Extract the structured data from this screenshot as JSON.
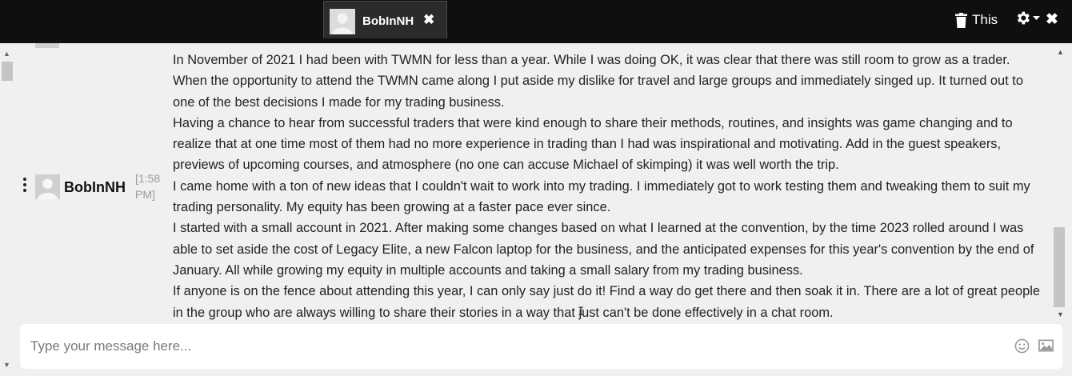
{
  "tab": {
    "name": "BobInNH",
    "close_glyph": "✖"
  },
  "top_actions": {
    "clear_label": "This",
    "trash_icon": "trash-icon",
    "settings_icon": "gear-icon",
    "close_glyph": "✖"
  },
  "message": {
    "author": "BobInNH",
    "time": "[1:58 PM]",
    "paragraphs": [
      "In November of 2021 I had been with TWMN for less than a year. While I was doing OK, it was clear that there was still room to grow as a trader. When the opportunity to attend the TWMN came along I put aside my dislike for travel and large groups and immediately singed up. It turned out to one of the best decisions I made for my trading business.",
      "Having a chance to hear from successful traders that were kind enough to share their methods, routines, and insights was game changing and to realize that at one time most of them had no more experience in trading than I had was inspirational and motivating. Add in the guest speakers, previews of upcoming courses, and atmosphere (no one can accuse Michael of skimping) it was well worth the trip.",
      "I came home with a ton of new ideas that I couldn't wait to work into my trading. I immediately got to work testing them and tweaking them to suit my trading personality. My equity has been growing at a faster pace ever since.",
      "I started with a small account in 2021. After making some changes based on what I learned at the convention, by the time 2023 rolled around I was able to set aside the cost of Legacy Elite, a new Falcon laptop for the business, and the anticipated expenses for this year's convention by the end of January. All while growing my equity in multiple accounts and taking a small salary from my trading business.",
      "If anyone is on the fence about attending this year, I can only say just do it! Find a way do get there and then soak it in. There are a lot of great people in the group who are always willing to share their stories in a way that just can't be done effectively in a chat room."
    ]
  },
  "composer": {
    "placeholder": "Type your message here...",
    "emoji_icon": "emoji-icon",
    "image_icon": "image-icon"
  }
}
